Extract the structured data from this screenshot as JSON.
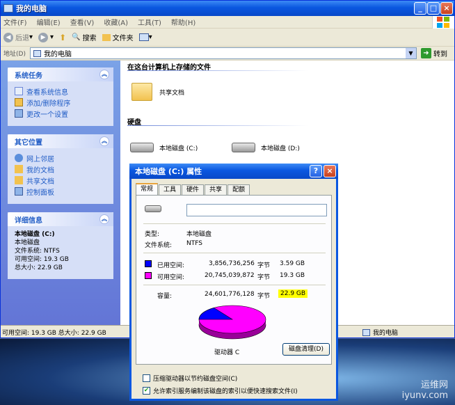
{
  "window": {
    "title": "我的电脑",
    "controls": {
      "minimize": "_",
      "maximize": "□",
      "close": "×"
    }
  },
  "menu": {
    "items": [
      "文件(F)",
      "编辑(E)",
      "查看(V)",
      "收藏(A)",
      "工具(T)",
      "帮助(H)"
    ]
  },
  "toolbar": {
    "back_label": "后退",
    "search_label": "搜索",
    "folders_label": "文件夹"
  },
  "address": {
    "label": "地址(D)",
    "value": "我的电脑",
    "go_label": "转到"
  },
  "sidebar": {
    "system_tasks": {
      "title": "系统任务",
      "items": [
        "查看系统信息",
        "添加/删除程序",
        "更改一个设置"
      ]
    },
    "other_places": {
      "title": "其它位置",
      "items": [
        "网上邻居",
        "我的文档",
        "共享文档",
        "控制面板"
      ]
    },
    "details": {
      "title": "详细信息",
      "name": "本地磁盘 (C:)",
      "type": "本地磁盘",
      "fs": "文件系统: NTFS",
      "free": "可用空间: 19.3 GB",
      "total": "总大小: 22.9 GB"
    }
  },
  "content": {
    "stored_title": "在这台计算机上存储的文件",
    "shared_docs": "共享文档",
    "hdd_title": "硬盘",
    "drive_c": "本地磁盘 (C:)",
    "drive_d": "本地磁盘 (D:)"
  },
  "status": {
    "left": "可用空间: 19.3 GB 总大小: 22.9 GB",
    "right": "我的电脑"
  },
  "dialog": {
    "title": "本地磁盘 (C:) 属性",
    "help": "?",
    "close": "×",
    "tabs": [
      "常规",
      "工具",
      "硬件",
      "共享",
      "配额"
    ],
    "label_value": "",
    "type_label": "类型:",
    "type_value": "本地磁盘",
    "fs_label": "文件系统:",
    "fs_value": "NTFS",
    "used_label": "已用空间:",
    "used_bytes": "3,856,736,256",
    "used_unit": "字节",
    "used_gb": "3.59 GB",
    "free_label": "可用空间:",
    "free_bytes": "20,745,039,872",
    "free_unit": "字节",
    "free_gb": "19.3 GB",
    "cap_label": "容量:",
    "cap_bytes": "24,601,776,128",
    "cap_unit": "字节",
    "cap_gb": "22.9 GB",
    "drive_label": "驱动器 C",
    "cleanup_button": "磁盘清理(D)",
    "compress_label": "压缩驱动器以节约磁盘空间(C)",
    "index_label": "允许索引服务编制该磁盘的索引以便快速搜索文件(I)",
    "compress_checked": false,
    "index_checked": true,
    "used_color": "#0000ff",
    "free_color": "#ff00ff",
    "used_fraction": 0.157
  },
  "watermark": {
    "line1": "运维网",
    "line2": "iyunv.com"
  }
}
